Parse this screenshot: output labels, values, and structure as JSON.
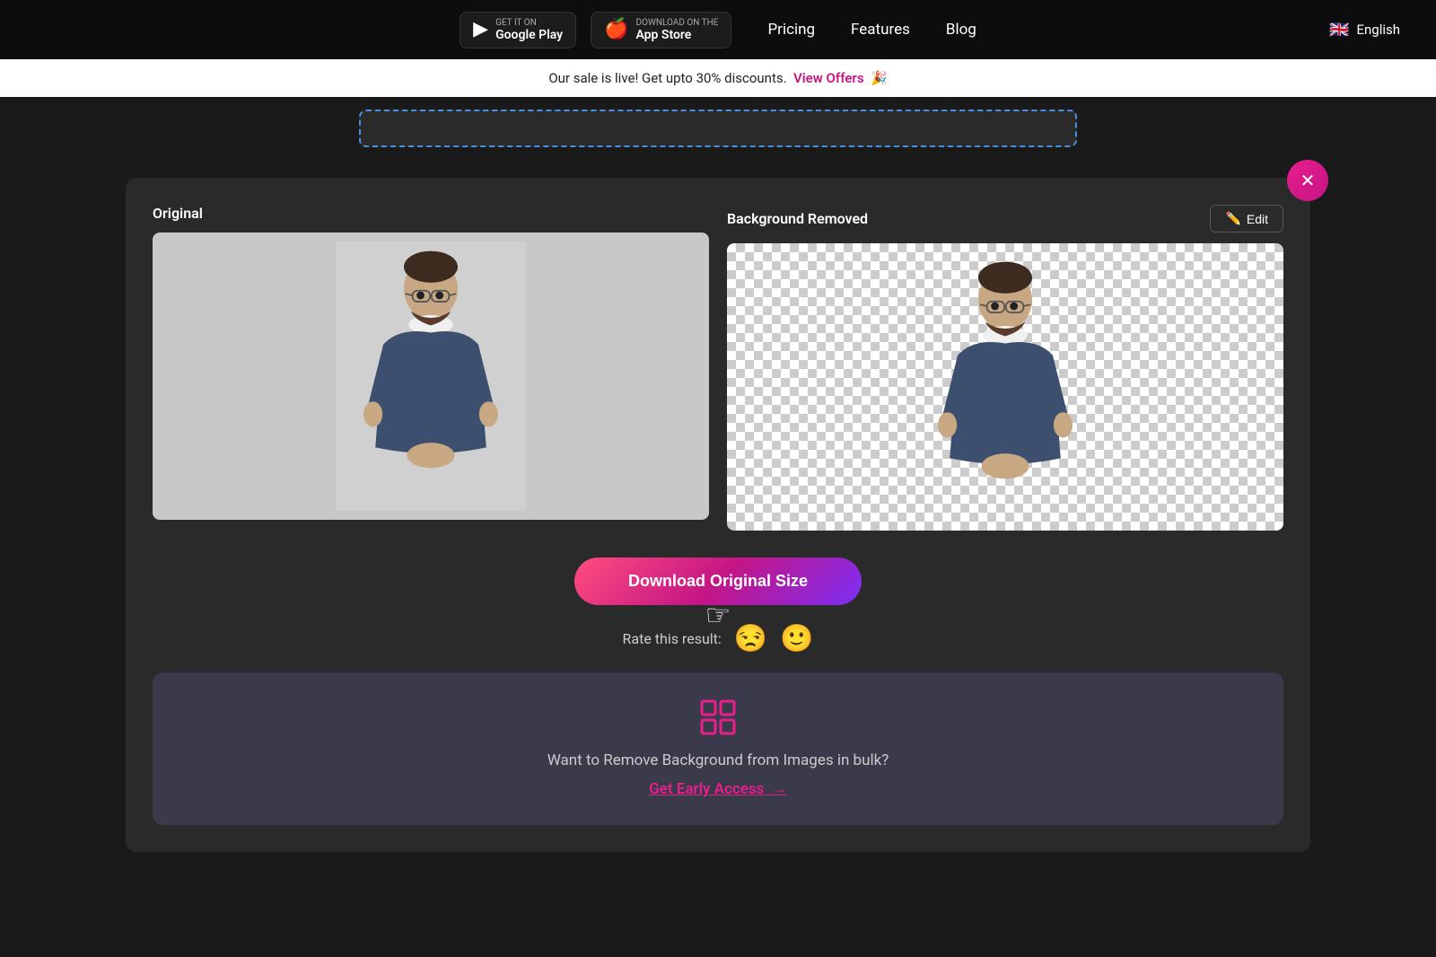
{
  "nav": {
    "google_play_label": "GET IT ON",
    "google_play_store": "Google Play",
    "apple_label": "Download on the",
    "apple_store": "App Store",
    "links": [
      {
        "id": "pricing",
        "label": "Pricing"
      },
      {
        "id": "features",
        "label": "Features"
      },
      {
        "id": "blog",
        "label": "Blog"
      }
    ],
    "language": "English",
    "lang_flag": "🇬🇧"
  },
  "sale_banner": {
    "text": "Our sale is live! Get upto 30% discounts.",
    "link_label": "View Offers",
    "emoji": "🎉"
  },
  "result": {
    "original_label": "Original",
    "bg_removed_label": "Background Removed",
    "edit_button_label": "Edit",
    "edit_icon": "✏️",
    "close_icon": "✕",
    "download_button": "Download Original Size",
    "rate_label": "Rate this result:",
    "emoji_bad": "😒",
    "emoji_good": "🙂"
  },
  "bulk_cta": {
    "icon": "❋",
    "text": "Want to Remove Background from Images in bulk?",
    "link_label": "Get Early Access",
    "arrow": "→"
  }
}
